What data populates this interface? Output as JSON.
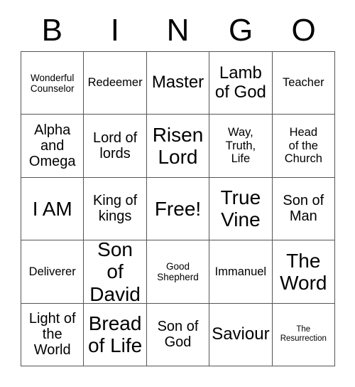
{
  "card": {
    "title_letters": [
      "B",
      "I",
      "N",
      "G",
      "O"
    ],
    "rows": [
      [
        {
          "text": "Wonderful\nCounselor",
          "size": "fs-sm"
        },
        {
          "text": "Redeemer",
          "size": "fs-md"
        },
        {
          "text": "Master",
          "size": "fs-xl"
        },
        {
          "text": "Lamb\nof God",
          "size": "fs-xl"
        },
        {
          "text": "Teacher",
          "size": "fs-md"
        }
      ],
      [
        {
          "text": "Alpha\nand\nOmega",
          "size": "fs-lg"
        },
        {
          "text": "Lord of\nlords",
          "size": "fs-lg"
        },
        {
          "text": "Risen\nLord",
          "size": "fs-xxl"
        },
        {
          "text": "Way,\nTruth,\nLife",
          "size": "fs-md"
        },
        {
          "text": "Head\nof the\nChurch",
          "size": "fs-md"
        }
      ],
      [
        {
          "text": "I AM",
          "size": "fs-xxl"
        },
        {
          "text": "King of\nkings",
          "size": "fs-lg"
        },
        {
          "text": "Free!",
          "size": "fs-xxl"
        },
        {
          "text": "True\nVine",
          "size": "fs-xxl"
        },
        {
          "text": "Son of\nMan",
          "size": "fs-lg"
        }
      ],
      [
        {
          "text": "Deliverer",
          "size": "fs-md"
        },
        {
          "text": "Son of\nDavid",
          "size": "fs-xxl"
        },
        {
          "text": "Good\nShepherd",
          "size": "fs-sm"
        },
        {
          "text": "Immanuel",
          "size": "fs-md"
        },
        {
          "text": "The\nWord",
          "size": "fs-xxl"
        }
      ],
      [
        {
          "text": "Light of\nthe\nWorld",
          "size": "fs-lg"
        },
        {
          "text": "Bread\nof Life",
          "size": "fs-xxl"
        },
        {
          "text": "Son of\nGod",
          "size": "fs-lg"
        },
        {
          "text": "Saviour",
          "size": "fs-xl"
        },
        {
          "text": "The\nResurrection",
          "size": "fs-xs"
        }
      ]
    ],
    "colors": {
      "text": "#000000",
      "border": "#555555",
      "background": "#ffffff"
    }
  }
}
